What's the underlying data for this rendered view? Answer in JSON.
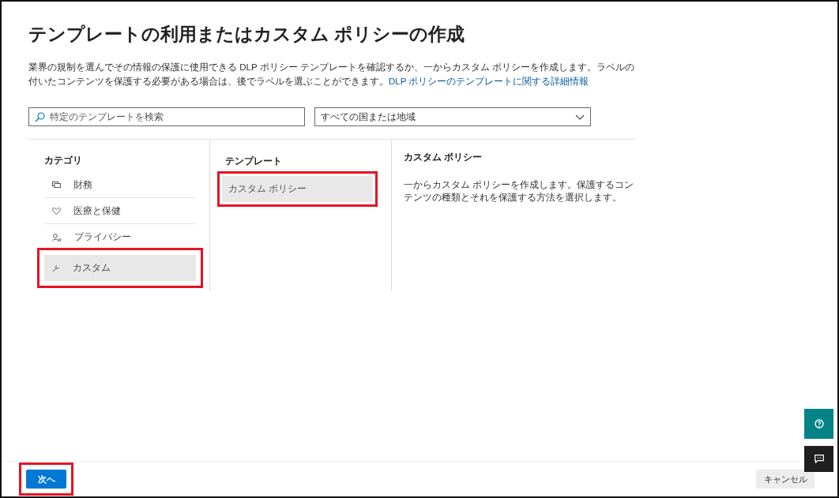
{
  "title": "テンプレートの利用またはカスタム ポリシーの作成",
  "description": {
    "text": "業界の規制を選んでその情報の保護に使用できる DLP ポリシー テンプレートを確認するか、一からカスタム ポリシーを作成します。ラベルの付いたコンテンツを保護する必要がある場合は、後でラベルを選ぶことができます。",
    "link": "DLP ポリシーのテンプレートに関する詳細情報"
  },
  "search": {
    "placeholder": "特定のテンプレートを検索"
  },
  "region_dropdown": {
    "value": "すべての国または地域"
  },
  "categories": {
    "heading": "カテゴリ",
    "items": [
      {
        "label": "財務",
        "kind": "finance",
        "selected": false,
        "highlighted": false
      },
      {
        "label": "医療と保健",
        "kind": "health",
        "selected": false,
        "highlighted": false
      },
      {
        "label": "プライバシー",
        "kind": "privacy",
        "selected": false,
        "highlighted": false
      },
      {
        "label": "カスタム",
        "kind": "custom",
        "selected": true,
        "highlighted": true
      }
    ]
  },
  "templates": {
    "heading": "テンプレート",
    "items": [
      {
        "label": "カスタム ポリシー",
        "selected": true,
        "highlighted": true
      }
    ]
  },
  "details": {
    "title": "カスタム ポリシー",
    "text": "一からカスタム ポリシーを作成します。保護するコンテンツの種類とそれを保護する方法を選択します。"
  },
  "footer": {
    "next": {
      "label": "次へ",
      "highlighted": true
    },
    "cancel": {
      "label": "キャンセル"
    }
  }
}
